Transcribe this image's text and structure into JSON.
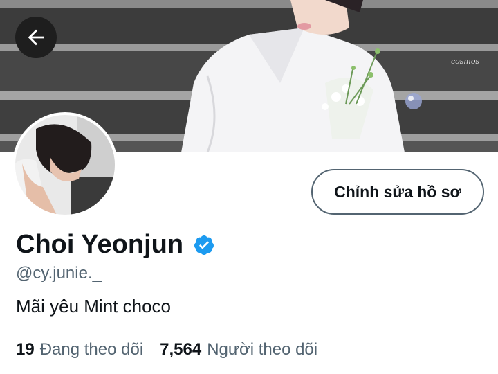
{
  "header": {
    "watermark": "cosmos",
    "back_icon": "arrow-left-icon"
  },
  "profile": {
    "edit_button_label": "Chỉnh sửa hồ sơ",
    "display_name": "Choi Yeonjun",
    "verified_icon": "verified-badge-icon",
    "verified_color": "#1d9bf0",
    "handle": "@cy.junie._",
    "bio": "Mãi yêu Mint choco"
  },
  "stats": {
    "following_count": "19",
    "following_label": "Đang theo dõi",
    "followers_count": "7,564",
    "followers_label": "Người theo dõi"
  }
}
